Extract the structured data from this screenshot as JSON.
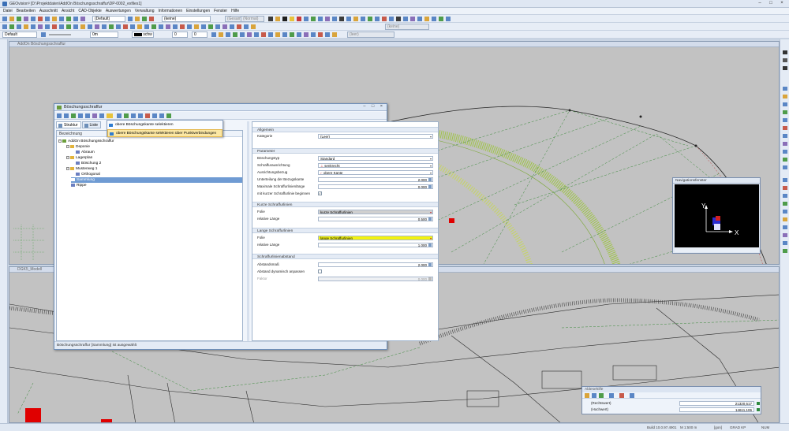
{
  "window": {
    "title": "GEOvision³ [D:\\Projektdaten\\AddOn Böschungsschraffur\\DP-0002_exfiles1]",
    "controls": [
      "–",
      "□",
      "×"
    ]
  },
  "menu": [
    "Datei",
    "Bearbeiten",
    "Ausschnitt",
    "Ansicht",
    "CAD-Objekte",
    "Auswertungen",
    "Verwaltung",
    "Informationen",
    "Einstellungen",
    "Fenster",
    "Hilfe"
  ],
  "toolbar": {
    "combo_default": "(Default)",
    "combo_keine": "(keine)",
    "combo_gesamt": "(Gesamt)",
    "combo_normal": "(Normal)",
    "combo_keine_gray": "(keine)",
    "combo_keine2": "(keine)",
    "combo_leer": "(leer)",
    "style_default": "Default",
    "line_width": "0m",
    "color_label": "schw",
    "rotation": "0",
    "extra_0": "0"
  },
  "views": {
    "top_title": "AddOn Böschungsschraffur",
    "bottom_title": "DGK5_Modell"
  },
  "dialog": {
    "title": "Böschungsschraffur",
    "controls": "– □ ×",
    "tabs": [
      "Struktur",
      "Liste"
    ],
    "tree_header": "Bezeichnung",
    "tree": [
      {
        "label": "AddOn Böschungsschraffur",
        "level": 0,
        "expander": "−",
        "sel": false,
        "icon": "#6b9e3b"
      },
      {
        "label": "Deponie",
        "level": 1,
        "expander": "−",
        "sel": false,
        "icon": "#e2b33a"
      },
      {
        "label": "Abraum",
        "level": 2,
        "expander": "",
        "sel": false,
        "icon": "#6b7fc0"
      },
      {
        "label": "Lagerplan",
        "level": 1,
        "expander": "−",
        "sel": false,
        "icon": "#e2b33a"
      },
      {
        "label": "Böschung 2",
        "level": 2,
        "expander": "",
        "sel": false,
        "icon": "#6b7fc0"
      },
      {
        "label": "Musterweg 1",
        "level": 1,
        "expander": "−",
        "sel": false,
        "icon": "#e2b33a"
      },
      {
        "label": "Orthogonal",
        "level": 2,
        "expander": "",
        "sel": false,
        "icon": "#6b7fc0"
      },
      {
        "label": "Sammlung",
        "level": 1,
        "expander": "",
        "sel": true,
        "icon": "#6b7fc0"
      },
      {
        "label": "Rippe",
        "level": 1,
        "expander": "",
        "sel": false,
        "icon": "#6b7fc0"
      }
    ],
    "status": "Böschungsschraffur [Sammlung] ist ausgewählt"
  },
  "popup": {
    "item1": "obere Böschungskante selektieren",
    "item2": "obere Böschungskante selektieren über Punktverbindungen"
  },
  "props": {
    "sec_top": "Allgemein",
    "kategorie": {
      "label": "Kategorie",
      "value": "(Leer)"
    },
    "sec_parameter": "Parameter",
    "boeschungstyp": {
      "label": "Böschungstyp",
      "value": "Standard"
    },
    "schraffurausrichtung": {
      "label": "Schraffurausrichtung",
      "value": "senkrecht"
    },
    "ausrichtungsbezug": {
      "label": "Ausrichtungsbezug",
      "value": "obere Kante"
    },
    "unterteilung": {
      "label": "Unterteilung der Bezugskante",
      "value": "2,000"
    },
    "maximale": {
      "label": "Maximale Schraffurlinienlänge",
      "value": "0,000"
    },
    "mitkurzer": {
      "label": "mit kurzer Schraffurlinie beginnen",
      "value": "✓"
    },
    "sec_kurze": "Kurze Schraffurlinien",
    "kurze_folie": {
      "label": "Folie",
      "value": "kurze Schraffurlinien"
    },
    "kurze_laenge": {
      "label": "relative Länge",
      "value": "0,500"
    },
    "sec_lange": "Lange Schraffurlinien",
    "lange_folie": {
      "label": "Folie",
      "value": "lange Schraffurlinien"
    },
    "lange_laenge": {
      "label": "relative Länge",
      "value": "1,000"
    },
    "sec_abstand": "Schraffurlinienabstand",
    "abstandsmass": {
      "label": "Abstandsmaß",
      "value": "2,000"
    },
    "dynamisch": {
      "label": "Abstand dynamisch anpassen",
      "value": ""
    },
    "faktor": {
      "label": "Faktor",
      "value": "0,000"
    }
  },
  "navigator": {
    "title": "Navigationsfenster",
    "axis_y": "Y",
    "axis_x": "X"
  },
  "coords": {
    "title": "Ablesehilfe",
    "rows": [
      {
        "label": "(Rechtswert)",
        "value": "21320,517"
      },
      {
        "label": "(Hochwert)",
        "value": "14611,106"
      }
    ]
  },
  "status": {
    "build": "Build 10.0.97.4901",
    "scale": "M 1:500 m",
    "unit": "[gon]",
    "snap": "GRAD KP",
    "num": "NUM"
  },
  "colors": {
    "accent": "#3a6fb6",
    "highlight": "#f2f20f",
    "selection": "#6f9bd3"
  }
}
